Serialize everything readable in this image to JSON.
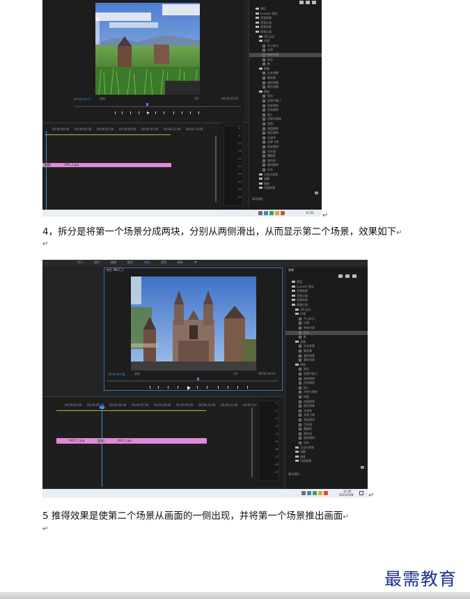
{
  "shot1": {
    "timecode_left": "00:00:04:11",
    "fit_label": "适合",
    "ratio_label": "1/2",
    "timecode_right": "00:00:10:01",
    "ruler_ticks": [
      "00:00:00:00",
      "00:00:05:00",
      "00:00:07:00",
      "00:00:09:00",
      "00:00:10:00",
      "00:00:11:00",
      "00:00:13:00"
    ],
    "clips": [
      {
        "label": "图像"
      },
      {
        "label": "IMG_2.jpg"
      }
    ],
    "meter_scale": [
      "0",
      "-6",
      "-12",
      "-18",
      "-24",
      "-30",
      "-36",
      "-42",
      "-48",
      "-54"
    ],
    "tree": [
      {
        "kind": "folder",
        "label": "预设",
        "indent": 1
      },
      {
        "kind": "folder",
        "label": "Lumetri 预设",
        "indent": 1
      },
      {
        "kind": "folder",
        "label": "音频效果",
        "indent": 1
      },
      {
        "kind": "folder",
        "label": "音频过渡",
        "indent": 1
      },
      {
        "kind": "folder",
        "label": "视频效果",
        "indent": 1
      },
      {
        "kind": "folder",
        "label": "视频过渡",
        "indent": 1,
        "open": true
      },
      {
        "kind": "folder",
        "label": "3D 运动",
        "indent": 2
      },
      {
        "kind": "folder",
        "label": "内滑",
        "indent": 2,
        "open": true
      },
      {
        "kind": "fx",
        "label": "中心拆分",
        "indent": 3
      },
      {
        "kind": "fx",
        "label": "内滑",
        "indent": 3
      },
      {
        "kind": "fx",
        "label": "带状内滑",
        "indent": 3,
        "selected": true
      },
      {
        "kind": "fx",
        "label": "拆分",
        "indent": 3
      },
      {
        "kind": "fx",
        "label": "推",
        "indent": 3
      },
      {
        "kind": "folder",
        "label": "划像",
        "indent": 2,
        "open": true
      },
      {
        "kind": "fx",
        "label": "交叉划像",
        "indent": 3
      },
      {
        "kind": "fx",
        "label": "圆划像",
        "indent": 3
      },
      {
        "kind": "fx",
        "label": "盒形划像",
        "indent": 3
      },
      {
        "kind": "fx",
        "label": "菱形划像",
        "indent": 3
      },
      {
        "kind": "folder",
        "label": "擦除",
        "indent": 2,
        "open": true
      },
      {
        "kind": "fx",
        "label": "划出",
        "indent": 3
      },
      {
        "kind": "fx",
        "label": "双侧平推门",
        "indent": 3
      },
      {
        "kind": "fx",
        "label": "带状擦除",
        "indent": 3
      },
      {
        "kind": "fx",
        "label": "径向擦除",
        "indent": 3
      },
      {
        "kind": "fx",
        "label": "插入",
        "indent": 3
      },
      {
        "kind": "fx",
        "label": "时钟式擦除",
        "indent": 3
      },
      {
        "kind": "fx",
        "label": "棋盘",
        "indent": 3
      },
      {
        "kind": "fx",
        "label": "棋盘擦除",
        "indent": 3
      },
      {
        "kind": "fx",
        "label": "楔形擦除",
        "indent": 3
      },
      {
        "kind": "fx",
        "label": "水波块",
        "indent": 3
      },
      {
        "kind": "fx",
        "label": "油漆飞溅",
        "indent": 3
      },
      {
        "kind": "fx",
        "label": "渐变擦除",
        "indent": 3
      },
      {
        "kind": "fx",
        "label": "百叶窗",
        "indent": 3
      },
      {
        "kind": "fx",
        "label": "螺旋框",
        "indent": 3
      },
      {
        "kind": "fx",
        "label": "随机块",
        "indent": 3
      },
      {
        "kind": "fx",
        "label": "随机擦除",
        "indent": 3
      },
      {
        "kind": "fx",
        "label": "风车",
        "indent": 3
      },
      {
        "kind": "folder",
        "label": "沉浸式视频",
        "indent": 2
      },
      {
        "kind": "folder",
        "label": "溶解",
        "indent": 2
      },
      {
        "kind": "folder",
        "label": "缩放",
        "indent": 2
      },
      {
        "kind": "folder",
        "label": "页面剥落",
        "indent": 2
      }
    ],
    "bottom_label": "基本图形",
    "taskbar_time": "11:02"
  },
  "para4": "4，拆分是将第一个场景分成两块，分别从两侧滑出，从而显示第二个场景，效果如下",
  "shot2": {
    "menu": [
      "学习",
      "组件",
      "编辑",
      "颜色",
      "效果",
      "音频",
      "图形",
      "库"
    ],
    "program_title": "节目: IMG7_1",
    "effects_title": "效果",
    "timecode_left": "00:00:03:08",
    "fit_label": "适合",
    "ratio_label": "1/2",
    "timecode_right": "00:00:10:01",
    "ruler_ticks": [
      "00:00:04:00",
      "00:00:05:00",
      "00:00:06:00",
      "00:00:07:00",
      "00:00:08:00",
      "00:00:09:00",
      "00:00:10:00",
      "00:00:11:00",
      "00:00:12:00"
    ],
    "clips": [
      {
        "label": "IMG7_1.jpg"
      },
      {
        "label": "拆分"
      },
      {
        "label": "IMG_2.jpg"
      }
    ],
    "meter_scale": [
      "0",
      "-6",
      "-12",
      "-18",
      "-24",
      "-30",
      "-36",
      "-42",
      "-48",
      "-54"
    ],
    "tree": [
      {
        "kind": "folder",
        "label": "预设",
        "indent": 1
      },
      {
        "kind": "folder",
        "label": "Lumetri 预设",
        "indent": 1
      },
      {
        "kind": "folder",
        "label": "音频效果",
        "indent": 1
      },
      {
        "kind": "folder",
        "label": "音频过渡",
        "indent": 1
      },
      {
        "kind": "folder",
        "label": "视频效果",
        "indent": 1
      },
      {
        "kind": "folder",
        "label": "视频过渡",
        "indent": 1,
        "open": true
      },
      {
        "kind": "folder",
        "label": "3D 运动",
        "indent": 2
      },
      {
        "kind": "folder",
        "label": "内滑",
        "indent": 2,
        "open": true
      },
      {
        "kind": "fx",
        "label": "中心拆分",
        "indent": 3
      },
      {
        "kind": "fx",
        "label": "内滑",
        "indent": 3
      },
      {
        "kind": "fx",
        "label": "带状内滑",
        "indent": 3
      },
      {
        "kind": "fx",
        "label": "拆分",
        "indent": 3,
        "selected": true
      },
      {
        "kind": "fx",
        "label": "推",
        "indent": 3
      },
      {
        "kind": "folder",
        "label": "划像",
        "indent": 2,
        "open": true
      },
      {
        "kind": "fx",
        "label": "交叉划像",
        "indent": 3
      },
      {
        "kind": "fx",
        "label": "圆划像",
        "indent": 3
      },
      {
        "kind": "fx",
        "label": "盒形划像",
        "indent": 3
      },
      {
        "kind": "fx",
        "label": "菱形划像",
        "indent": 3
      },
      {
        "kind": "folder",
        "label": "擦除",
        "indent": 2,
        "open": true
      },
      {
        "kind": "fx",
        "label": "划出",
        "indent": 3
      },
      {
        "kind": "fx",
        "label": "双侧平推门",
        "indent": 3
      },
      {
        "kind": "fx",
        "label": "带状擦除",
        "indent": 3
      },
      {
        "kind": "fx",
        "label": "径向擦除",
        "indent": 3
      },
      {
        "kind": "fx",
        "label": "插入",
        "indent": 3
      },
      {
        "kind": "fx",
        "label": "时钟式擦除",
        "indent": 3
      },
      {
        "kind": "fx",
        "label": "棋盘",
        "indent": 3
      },
      {
        "kind": "fx",
        "label": "棋盘擦除",
        "indent": 3
      },
      {
        "kind": "fx",
        "label": "楔形擦除",
        "indent": 3
      },
      {
        "kind": "fx",
        "label": "水波块",
        "indent": 3
      },
      {
        "kind": "fx",
        "label": "油漆飞溅",
        "indent": 3
      },
      {
        "kind": "fx",
        "label": "渐变擦除",
        "indent": 3
      },
      {
        "kind": "fx",
        "label": "百叶窗",
        "indent": 3
      },
      {
        "kind": "fx",
        "label": "螺旋框",
        "indent": 3
      },
      {
        "kind": "fx",
        "label": "随机块",
        "indent": 3
      },
      {
        "kind": "fx",
        "label": "随机擦除",
        "indent": 3
      },
      {
        "kind": "fx",
        "label": "风车",
        "indent": 3
      },
      {
        "kind": "folder",
        "label": "沉浸式视频",
        "indent": 2
      },
      {
        "kind": "folder",
        "label": "溶解",
        "indent": 2
      },
      {
        "kind": "folder",
        "label": "缩放",
        "indent": 2
      },
      {
        "kind": "folder",
        "label": "页面剥落",
        "indent": 2
      }
    ],
    "bottom_label": "基本图形",
    "taskbar_time": "11:05",
    "taskbar_date": "2021/10/8"
  },
  "para5": "5 推得效果是使第二个场景从画面的一侧出现，并将第一个场景推出画面",
  "return_mark": "↵",
  "watermark": "最需教育",
  "colors": {
    "playhead": "#3d8fe0",
    "clip": "#e08ad8",
    "watermark": "#1a2f8c"
  }
}
